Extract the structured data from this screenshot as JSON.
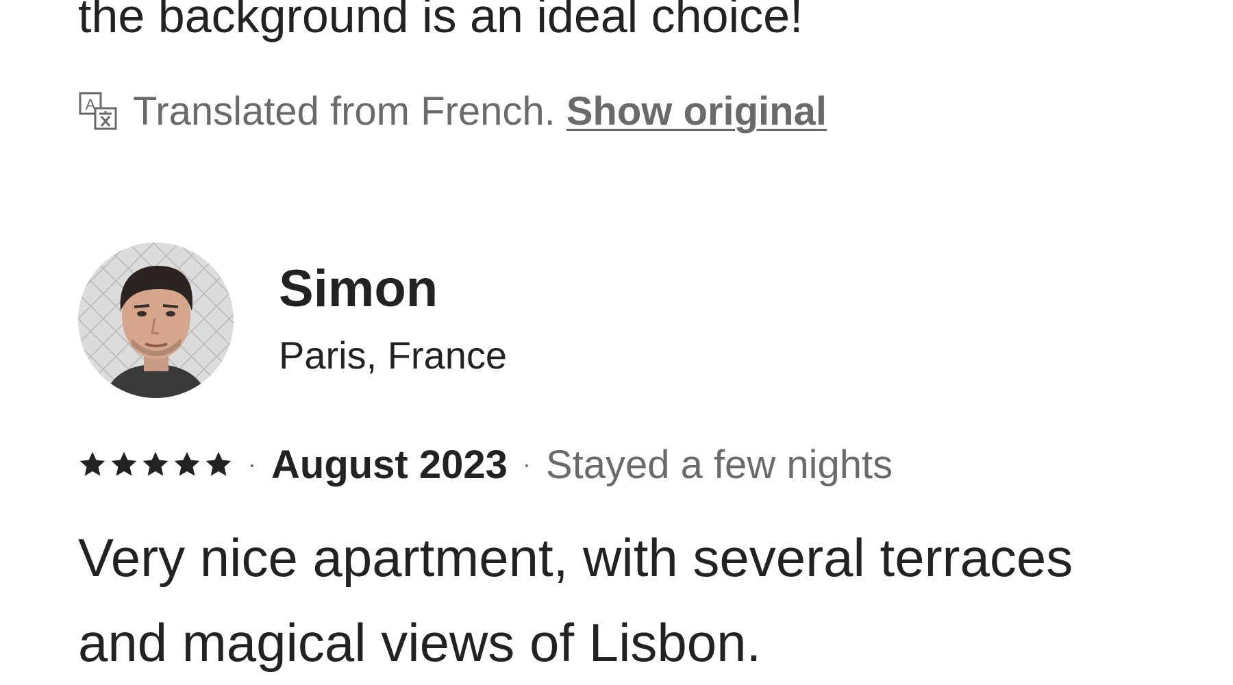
{
  "previous_review": {
    "text_tail": "the background is an ideal choice!"
  },
  "translation": {
    "icon": "translate-icon",
    "note": "Translated from French.",
    "show_original_label": "Show original"
  },
  "review": {
    "reviewer_name": "Simon",
    "reviewer_location": "Paris, France",
    "avatar_icon": "user-avatar-photo",
    "rating": 5,
    "rating_max": 5,
    "date": "August 2023",
    "stay_length": "Stayed a few nights",
    "body": "Very nice apartment, with several terraces and magical views of Lisbon."
  },
  "colors": {
    "text_primary": "#222222",
    "text_secondary": "#6a6a6a",
    "background": "#ffffff"
  }
}
